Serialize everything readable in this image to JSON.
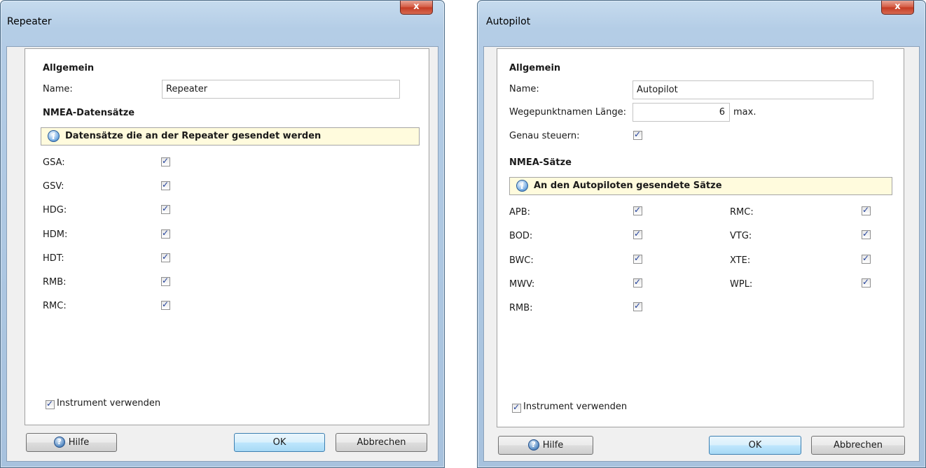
{
  "repeater": {
    "title": "Repeater",
    "close": "x",
    "general_heading": "Allgemein",
    "name_label": "Name:",
    "name_value": "Repeater",
    "nmea_heading": "NMEA-Datensätze",
    "info_icon": "i",
    "info_text": "Datensätze die an der Repeater gesendet werden",
    "sentences": [
      {
        "label": "GSA:",
        "checked": true
      },
      {
        "label": "GSV:",
        "checked": true
      },
      {
        "label": "HDG:",
        "checked": true
      },
      {
        "label": "HDM:",
        "checked": true
      },
      {
        "label": "HDT:",
        "checked": true
      },
      {
        "label": "RMB:",
        "checked": true
      },
      {
        "label": "RMC:",
        "checked": true
      }
    ],
    "use_instrument_label": "Instrument verwenden",
    "use_instrument_checked": true,
    "help_icon": "?",
    "help_label": "Hilfe",
    "ok_label": "OK",
    "cancel_label": "Abbrechen"
  },
  "autopilot": {
    "title": "Autopilot",
    "close": "x",
    "general_heading": "Allgemein",
    "name_label": "Name:",
    "name_value": "Autopilot",
    "waypoint_label": "Wegepunktnamen Länge:",
    "waypoint_value": "6",
    "waypoint_suffix": "max.",
    "steer_label": "Genau steuern:",
    "steer_checked": true,
    "nmea_heading": "NMEA-Sätze",
    "info_icon": "i",
    "info_text": "An den Autopiloten gesendete Sätze",
    "sentences_left": [
      {
        "label": "APB:",
        "checked": true
      },
      {
        "label": "BOD:",
        "checked": true
      },
      {
        "label": "BWC:",
        "checked": true
      },
      {
        "label": "MWV:",
        "checked": true
      },
      {
        "label": "RMB:",
        "checked": true
      }
    ],
    "sentences_right": [
      {
        "label": "RMC:",
        "checked": true
      },
      {
        "label": "VTG:",
        "checked": true
      },
      {
        "label": "XTE:",
        "checked": true
      },
      {
        "label": "WPL:",
        "checked": true
      }
    ],
    "use_instrument_label": "Instrument verwenden",
    "use_instrument_checked": true,
    "help_icon": "?",
    "help_label": "Hilfe",
    "ok_label": "OK",
    "cancel_label": "Abbrechen"
  }
}
